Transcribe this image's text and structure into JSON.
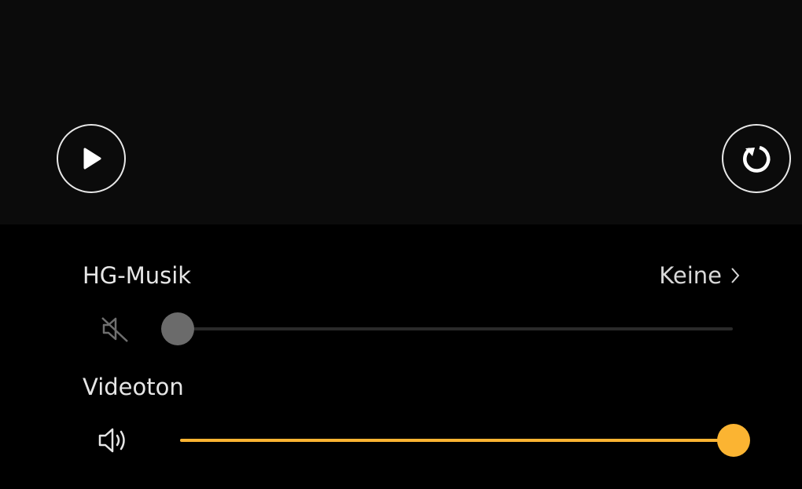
{
  "preview": {
    "play_icon": "play-icon",
    "replay_icon": "replay-icon"
  },
  "background_music": {
    "label": "HG-Musik",
    "value": "Keine",
    "volume_icon": "speaker-muted-icon",
    "volume": 0.0,
    "color": "#6b6b6b"
  },
  "video_sound": {
    "label": "Videoton",
    "volume_icon": "speaker-icon",
    "volume": 1.0,
    "color": "#fbb432"
  }
}
